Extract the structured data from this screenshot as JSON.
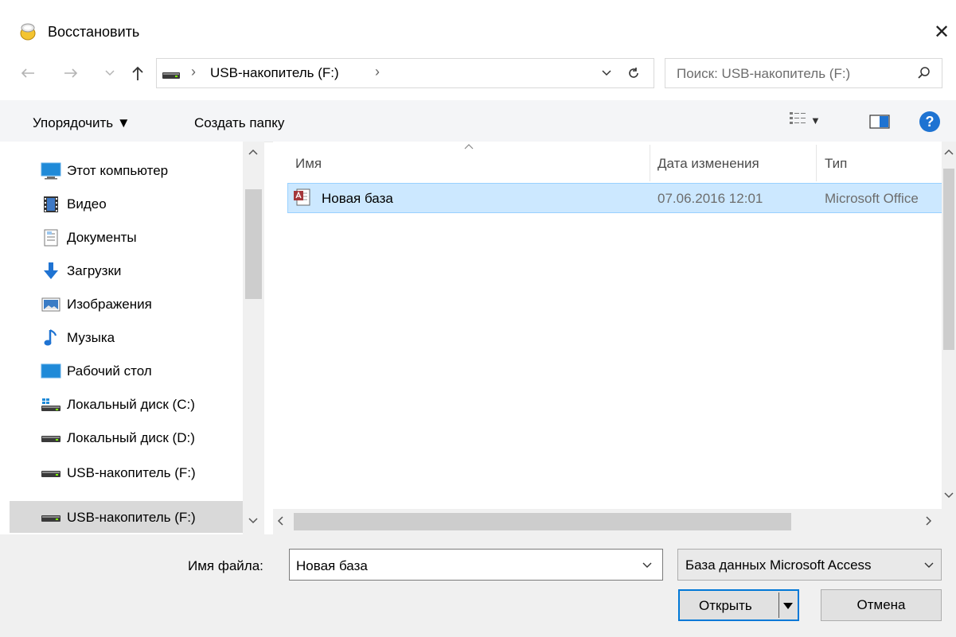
{
  "window": {
    "title": "Восстановить",
    "close_glyph": "✕"
  },
  "nav": {
    "back_icon": "arrow-left-icon",
    "forward_icon": "arrow-right-icon",
    "recent_icon": "chevron-down-icon",
    "up_icon": "arrow-up-icon",
    "breadcrumb": {
      "sep": "›",
      "current": "USB-накопитель (F:)"
    },
    "search_placeholder": "Поиск: USB-накопитель (F:)"
  },
  "toolbar": {
    "organize_label": "Упорядочить ▼",
    "new_folder_label": "Создать папку",
    "view_arrow": "▼",
    "help_glyph": "?"
  },
  "navpane": {
    "items": [
      {
        "label": "Этот компьютер",
        "icon": "computer-icon"
      },
      {
        "label": "Видео",
        "icon": "video-icon"
      },
      {
        "label": "Документы",
        "icon": "documents-icon"
      },
      {
        "label": "Загрузки",
        "icon": "downloads-icon"
      },
      {
        "label": "Изображения",
        "icon": "pictures-icon"
      },
      {
        "label": "Музыка",
        "icon": "music-icon"
      },
      {
        "label": "Рабочий стол",
        "icon": "desktop-icon"
      },
      {
        "label": "Локальный диск (C:)",
        "icon": "system-drive-icon"
      },
      {
        "label": "Локальный диск (D:)",
        "icon": "drive-icon"
      },
      {
        "label": "USB-накопитель (F:)",
        "icon": "usb-drive-icon"
      },
      {
        "label": "USB-накопитель (F:)",
        "icon": "usb-drive-icon"
      }
    ]
  },
  "filelist": {
    "columns": {
      "name": "Имя",
      "date": "Дата изменения",
      "type": "Тип"
    },
    "rows": [
      {
        "name": "Новая база",
        "date": "07.06.2016 12:01",
        "type": "Microsoft Office",
        "icon": "access-db-icon"
      }
    ]
  },
  "footer": {
    "filename_label": "Имя файла:",
    "filename_value": "Новая база",
    "filetype_value": "База данных Microsoft Access",
    "open_label": "Открыть",
    "cancel_label": "Отмена"
  },
  "colors": {
    "selection": "#cce8ff",
    "selection_border": "#99d1ff",
    "accent": "#0078d7",
    "help": "#1e73d2"
  }
}
